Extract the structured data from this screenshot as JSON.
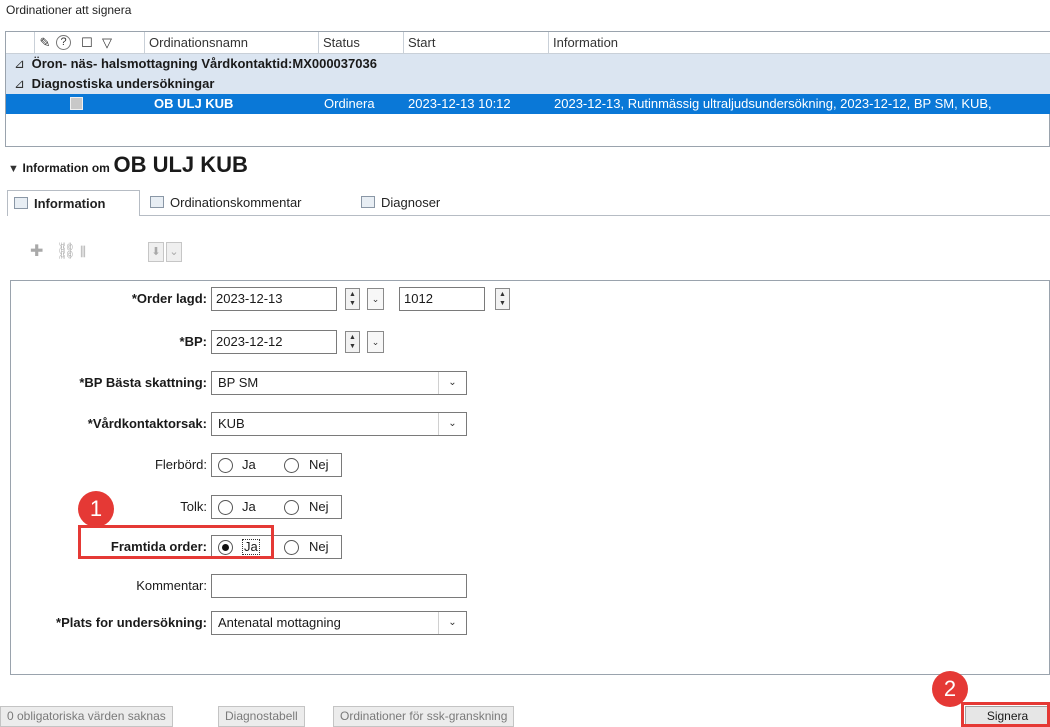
{
  "list": {
    "title": "Ordinationer att signera",
    "header_icons": [
      "signature-icon",
      "help-icon",
      "comment-icon",
      "filter-icon"
    ],
    "header_glyphs": [
      "✎",
      "?",
      "☐",
      "▽"
    ],
    "columns": [
      "Ordinationsnamn",
      "Status",
      "Start",
      "Information"
    ],
    "group1": "Öron- näs- halsmottagning Vårdkontaktid:MX000037036",
    "group2": "Diagnostiska undersökningar",
    "group_arrow": "⊿",
    "row": {
      "name": "OB ULJ KUB",
      "status": "Ordinera",
      "start": "2023-12-13 10:12",
      "info": "2023-12-13, Rutinmässig ultraljudsundersökning, 2023-12-12, BP SM, KUB,"
    }
  },
  "info": {
    "prefix": "Information om",
    "name": "OB ULJ KUB",
    "toggle": "▼"
  },
  "tabs": [
    {
      "label": "Information",
      "icon": "information-tab-icon"
    },
    {
      "label": "Ordinationskommentar",
      "icon": "comment-tab-icon"
    },
    {
      "label": "Diagnoser",
      "icon": "diagnosis-tab-icon"
    }
  ],
  "toolbar": {
    "add": "✚",
    "link": "⛓",
    "chart": "⫼",
    "down": "⬇",
    "chevron": "⌄"
  },
  "form": {
    "order_lagd_label": "*Order lagd:",
    "order_lagd_date": "2023-12-13",
    "order_lagd_time": "1012",
    "bp_label": "*BP:",
    "bp_date": "2023-12-12",
    "bp_basta_label": "*BP Bästa skattning:",
    "bp_basta_value": "BP SM",
    "vardkontakt_label": "*Vårdkontaktorsak:",
    "vardkontakt_value": "KUB",
    "flerbord_label": "Flerbörd:",
    "tolk_label": "Tolk:",
    "framtida_label": "Framtida order:",
    "ja": "Ja",
    "nej": "Nej",
    "framtida_selected": "Ja",
    "kommentar_label": "Kommentar:",
    "kommentar_value": "",
    "plats_label": "*Plats for undersökning:",
    "plats_value": "Antenatal mottagning",
    "caret": "⌄"
  },
  "annotations": {
    "badge1": "1",
    "badge2": "2",
    "color": "#e53935"
  },
  "bottom": {
    "missing": "0 obligatoriska värden saknas",
    "diagnostabell": "Diagnostabell",
    "ssk": "Ordinationer för ssk-granskning",
    "signera": "Signera"
  }
}
